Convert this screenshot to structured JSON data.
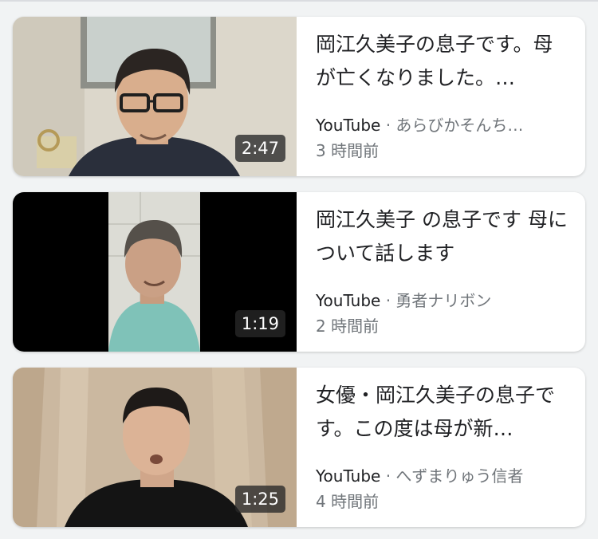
{
  "results": [
    {
      "title": "岡江久美子の息子です。母が亡くなりました。…",
      "source": "YouTube",
      "separator": "·",
      "channel": "あらびかそんち…",
      "time": "3 時間前",
      "duration": "2:47"
    },
    {
      "title": "岡江久美子 の息子です 母について話します",
      "source": "YouTube",
      "separator": "·",
      "channel": "勇者ナリボン",
      "time": "2 時間前",
      "duration": "1:19"
    },
    {
      "title": "女優・岡江久美子の息子です。この度は母が新…",
      "source": "YouTube",
      "separator": "·",
      "channel": "へずまりゅう信者",
      "time": "4 時間前",
      "duration": "1:25"
    }
  ]
}
